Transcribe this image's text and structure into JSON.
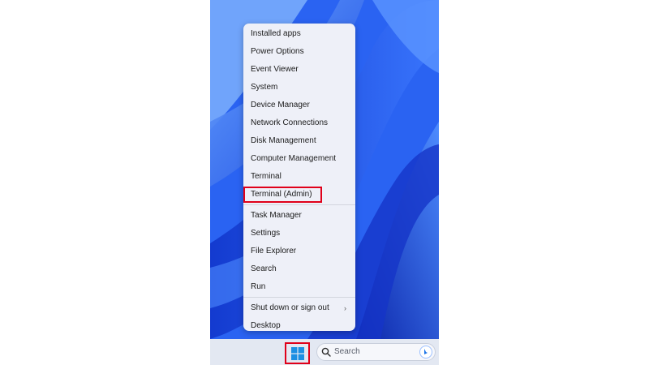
{
  "context_menu": {
    "items": [
      {
        "label": "Installed apps"
      },
      {
        "label": "Power Options"
      },
      {
        "label": "Event Viewer"
      },
      {
        "label": "System"
      },
      {
        "label": "Device Manager"
      },
      {
        "label": "Network Connections"
      },
      {
        "label": "Disk Management"
      },
      {
        "label": "Computer Management"
      },
      {
        "label": "Terminal"
      },
      {
        "label": "Terminal (Admin)",
        "highlighted": true
      },
      {
        "label": "Task Manager"
      },
      {
        "label": "Settings"
      },
      {
        "label": "File Explorer"
      },
      {
        "label": "Search"
      },
      {
        "label": "Run"
      },
      {
        "label": "Shut down or sign out",
        "submenu": true
      },
      {
        "label": "Desktop"
      }
    ]
  },
  "taskbar": {
    "search_placeholder": "Search",
    "start_icon": "windows-logo-icon",
    "search_icon": "search-icon",
    "bing_icon": "bing-icon"
  },
  "colors": {
    "highlight_border": "#e0001a",
    "windows_logo": "#1d8fe3",
    "menu_background": "#eef0f8",
    "taskbar_background": "#e3e8f2"
  }
}
